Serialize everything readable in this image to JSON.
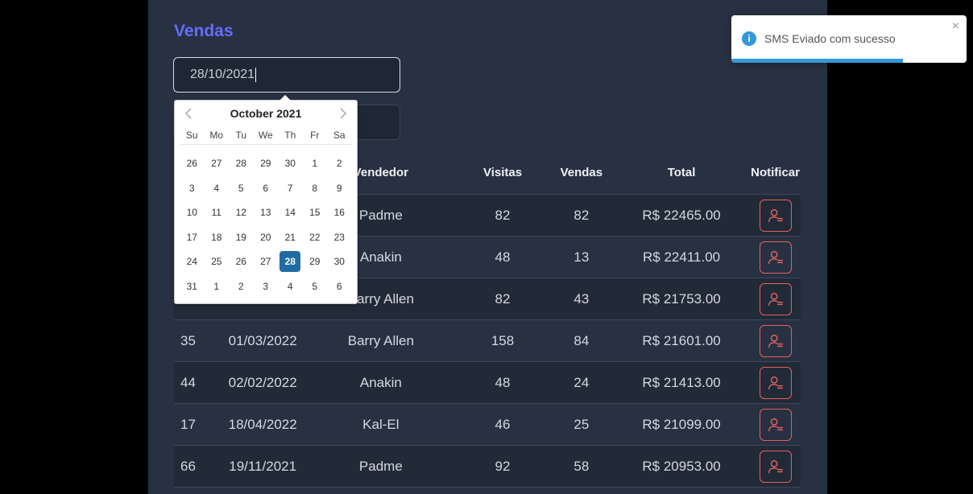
{
  "page": {
    "title": "Vendas"
  },
  "date_input": {
    "value": "28/10/2021"
  },
  "table": {
    "headers": [
      "Vendedor",
      "Visitas",
      "Vendas",
      "Total",
      "Notificar"
    ],
    "rows": [
      {
        "id": "",
        "date": "",
        "seller": "Padme",
        "visits": "82",
        "sales": "82",
        "total": "R$ 22465.00"
      },
      {
        "id": "",
        "date": "",
        "seller": "Anakin",
        "visits": "48",
        "sales": "13",
        "total": "R$ 22411.00"
      },
      {
        "id": "",
        "date": "",
        "seller": "Barry Allen",
        "visits": "82",
        "sales": "43",
        "total": "R$ 21753.00"
      },
      {
        "id": "35",
        "date": "01/03/2022",
        "seller": "Barry Allen",
        "visits": "158",
        "sales": "84",
        "total": "R$ 21601.00"
      },
      {
        "id": "44",
        "date": "02/02/2022",
        "seller": "Anakin",
        "visits": "48",
        "sales": "24",
        "total": "R$ 21413.00"
      },
      {
        "id": "17",
        "date": "18/04/2022",
        "seller": "Kal-El",
        "visits": "46",
        "sales": "25",
        "total": "R$ 21099.00"
      },
      {
        "id": "66",
        "date": "19/11/2021",
        "seller": "Padme",
        "visits": "92",
        "sales": "58",
        "total": "R$ 20953.00"
      }
    ]
  },
  "calendar": {
    "month_label": "October 2021",
    "weekdays": [
      "Su",
      "Mo",
      "Tu",
      "We",
      "Th",
      "Fr",
      "Sa"
    ],
    "weeks": [
      [
        "26",
        "27",
        "28",
        "29",
        "30",
        "1",
        "2"
      ],
      [
        "3",
        "4",
        "5",
        "6",
        "7",
        "8",
        "9"
      ],
      [
        "10",
        "11",
        "12",
        "13",
        "14",
        "15",
        "16"
      ],
      [
        "17",
        "18",
        "19",
        "20",
        "21",
        "22",
        "23"
      ],
      [
        "24",
        "25",
        "26",
        "27",
        "28",
        "29",
        "30"
      ],
      [
        "31",
        "1",
        "2",
        "3",
        "4",
        "5",
        "6"
      ]
    ],
    "selected_day": "28"
  },
  "toast": {
    "message": "SMS Eviado com sucesso",
    "close_glyph": "×",
    "icon_glyph": "i",
    "progress": 0.73
  },
  "colors": {
    "accent": "#646cff",
    "notify": "#e0605f",
    "selected_day": "#216ba5",
    "toast_info": "#3498db"
  }
}
